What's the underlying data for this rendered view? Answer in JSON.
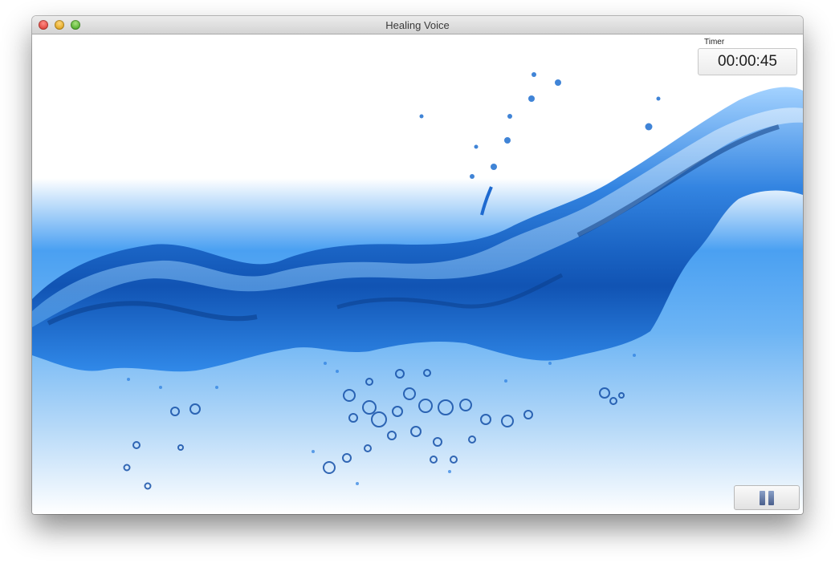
{
  "window": {
    "title": "Healing Voice"
  },
  "timer": {
    "label": "Timer",
    "value": "00:00:45"
  },
  "controls": {
    "pause_icon": "pause-icon"
  },
  "colors": {
    "water_blue": "#1f6fd0",
    "light_blue": "#6cb4f4"
  }
}
